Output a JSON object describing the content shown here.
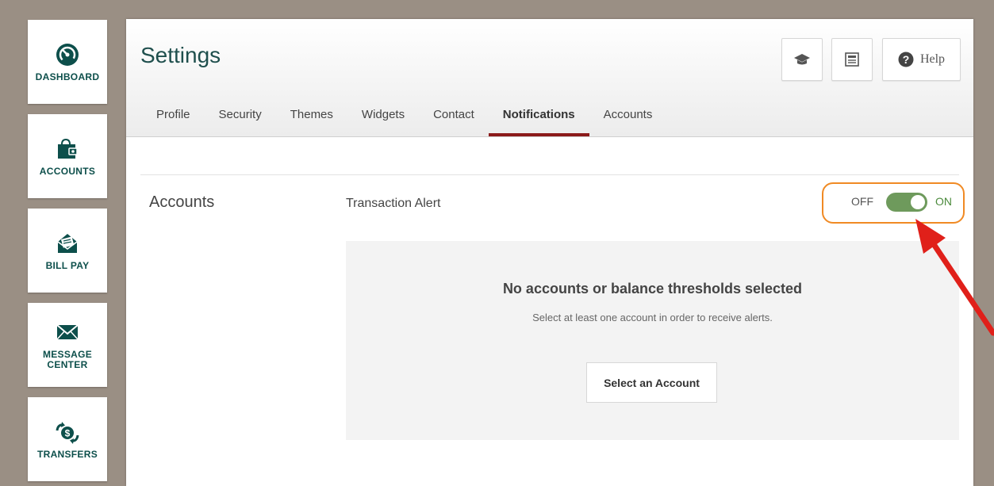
{
  "sidebar": {
    "items": [
      {
        "label_lines": [
          "DASHBOARD"
        ],
        "icon": "dashboard-gauge-icon"
      },
      {
        "label_lines": [
          "ACCOUNTS"
        ],
        "icon": "wallet-icon"
      },
      {
        "label_lines": [
          "BILL PAY"
        ],
        "icon": "envelope-check-icon"
      },
      {
        "label_lines": [
          "MESSAGE",
          "CENTER"
        ],
        "icon": "mail-icon"
      },
      {
        "label_lines": [
          "TRANSFERS"
        ],
        "icon": "dollar-transfer-icon"
      }
    ]
  },
  "header": {
    "title": "Settings",
    "tools": [
      {
        "icon": "graduation-cap-icon"
      },
      {
        "icon": "newspaper-icon"
      },
      {
        "icon": "help-icon",
        "label": "Help"
      }
    ]
  },
  "tabs": [
    {
      "label": "Profile",
      "active": false
    },
    {
      "label": "Security",
      "active": false
    },
    {
      "label": "Themes",
      "active": false
    },
    {
      "label": "Widgets",
      "active": false
    },
    {
      "label": "Contact",
      "active": false
    },
    {
      "label": "Notifications",
      "active": true
    },
    {
      "label": "Accounts",
      "active": false
    }
  ],
  "section": {
    "title": "Accounts",
    "alert_label": "Transaction Alert",
    "toggle": {
      "off_label": "OFF",
      "on_label": "ON",
      "state": "on"
    }
  },
  "empty_state": {
    "title": "No accounts or balance thresholds selected",
    "description": "Select at least one account in order to receive alerts.",
    "button_label": "Select an Account"
  },
  "colors": {
    "brand_teal": "#0d4f4b",
    "active_tab_underline": "#8b1a1a",
    "toggle_on": "#6e9a5c",
    "highlight_outline": "#f08a24",
    "annotation_arrow": "#e0201a",
    "background": "#9a8f84"
  }
}
